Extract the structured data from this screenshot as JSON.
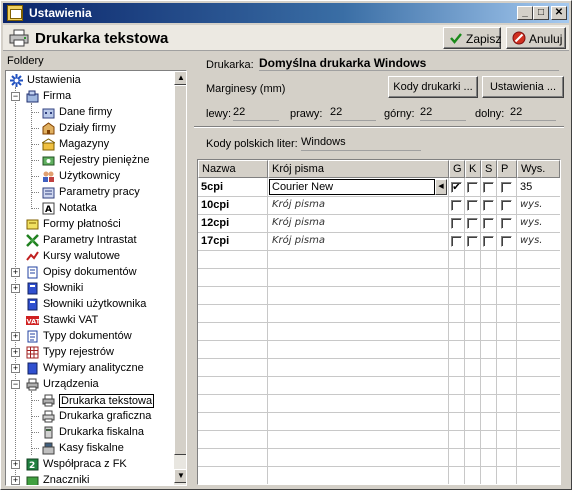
{
  "window": {
    "title": "Ustawienia"
  },
  "header": {
    "title": "Drukarka tekstowa",
    "save_label": "Zapisz",
    "cancel_label": "Anuluj"
  },
  "sidebar": {
    "label": "Foldery",
    "items": [
      {
        "label": "Ustawienia",
        "icon": "settings-icon"
      },
      {
        "label": "Firma",
        "icon": "firm-icon"
      },
      {
        "label": "Dane firmy",
        "icon": "company-data-icon"
      },
      {
        "label": "Działy firmy",
        "icon": "departments-icon"
      },
      {
        "label": "Magazyny",
        "icon": "warehouse-icon"
      },
      {
        "label": "Rejestry pieniężne",
        "icon": "money-register-icon"
      },
      {
        "label": "Użytkownicy",
        "icon": "users-icon"
      },
      {
        "label": "Parametry pracy",
        "icon": "parameters-icon"
      },
      {
        "label": "Notatka",
        "icon": "note-icon"
      },
      {
        "label": "Formy płatności",
        "icon": "payment-icon"
      },
      {
        "label": "Parametry Intrastat",
        "icon": "intrastat-icon"
      },
      {
        "label": "Kursy walutowe",
        "icon": "currency-icon"
      },
      {
        "label": "Opisy dokumentów",
        "icon": "document-descriptions-icon"
      },
      {
        "label": "Słowniki",
        "icon": "dictionary-icon"
      },
      {
        "label": "Słowniki użytkownika",
        "icon": "user-dictionary-icon"
      },
      {
        "label": "Stawki VAT",
        "icon": "vat-icon"
      },
      {
        "label": "Typy dokumentów",
        "icon": "document-types-icon"
      },
      {
        "label": "Typy rejestrów",
        "icon": "register-types-icon"
      },
      {
        "label": "Wymiary analityczne",
        "icon": "analytics-icon"
      },
      {
        "label": "Urządzenia",
        "icon": "devices-icon"
      },
      {
        "label": "Drukarka tekstowa",
        "icon": "text-printer-icon"
      },
      {
        "label": "Drukarka graficzna",
        "icon": "graphic-printer-icon"
      },
      {
        "label": "Drukarka fiskalna",
        "icon": "fiscal-printer-icon"
      },
      {
        "label": "Kasy fiskalne",
        "icon": "cash-register-icon"
      },
      {
        "label": "Współpraca z FK",
        "icon": "fk-icon"
      },
      {
        "label": "Znaczniki",
        "icon": "markers-icon"
      }
    ]
  },
  "form": {
    "printer_label": "Drukarka:",
    "printer_value": "Domyślna drukarka Windows",
    "margins_label": "Marginesy (mm)",
    "printer_codes_button": "Kody drukarki ...",
    "settings_button": "Ustawienia ...",
    "left_label": "lewy:",
    "left_value": "22",
    "right_label": "prawy:",
    "right_value": "22",
    "top_label": "górny:",
    "top_value": "22",
    "bottom_label": "dolny:",
    "bottom_value": "22",
    "polish_codes_label": "Kody polskich liter:",
    "polish_codes_value": "Windows"
  },
  "grid": {
    "headers": {
      "name": "Nazwa",
      "font": "Krój pisma",
      "g": "G",
      "k": "K",
      "s": "S",
      "p": "P",
      "height": "Wys."
    },
    "rows": [
      {
        "name": "5cpi",
        "font": "Courier New",
        "g": true,
        "k": false,
        "s": false,
        "p": false,
        "height": "35"
      },
      {
        "name": "10cpi",
        "font": "Krój pisma",
        "g": false,
        "k": false,
        "s": false,
        "p": false,
        "height": "wys."
      },
      {
        "name": "12cpi",
        "font": "Krój pisma",
        "g": false,
        "k": false,
        "s": false,
        "p": false,
        "height": "wys."
      },
      {
        "name": "17cpi",
        "font": "Krój pisma",
        "g": false,
        "k": false,
        "s": false,
        "p": false,
        "height": "wys."
      }
    ]
  }
}
